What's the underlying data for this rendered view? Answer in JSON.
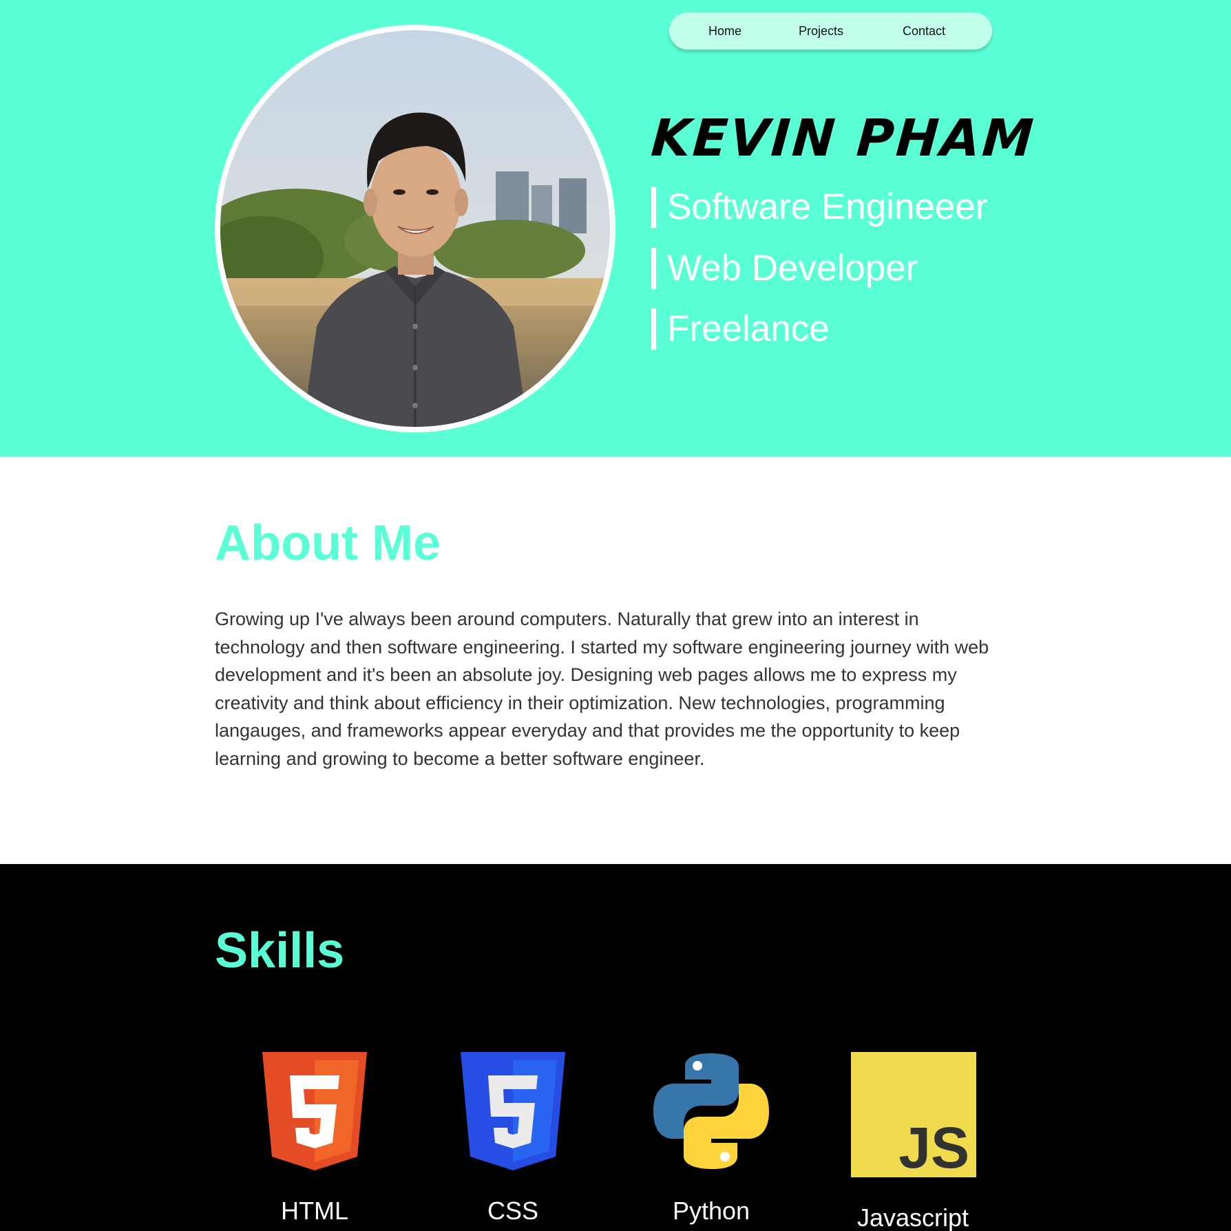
{
  "colors": {
    "accent": "#5bffd6",
    "nav_background": "#c1ffeb",
    "about_background": "#ffffff",
    "skills_background": "#000000",
    "html_orange": "#e44d26",
    "css_blue": "#264de4",
    "python_blue": "#3776ab",
    "python_yellow": "#ffd43b",
    "js_yellow": "#f0db4f"
  },
  "nav": {
    "items": [
      {
        "label": "Home"
      },
      {
        "label": "Projects"
      },
      {
        "label": "Contact"
      }
    ]
  },
  "hero": {
    "name": "KEVIN PHAM",
    "roles": [
      "Software Engineeer",
      "Web Developer",
      "Freelance"
    ],
    "portrait_icon": "profile-photo"
  },
  "about": {
    "title": "About Me",
    "text": "Growing up I've always been around computers. Naturally that grew into an interest in technology and then software engineering. I started my software engineering journey with web development and it's been an absolute joy. Designing web pages allows me to express my creativity and think about efficiency in their optimization. New technologies, programming langauges, and frameworks appear everyday and that provides me the opportunity to keep learning and growing to become a better software engineer."
  },
  "skills": {
    "title": "Skills",
    "items": [
      {
        "label": "HTML",
        "icon": "html5-logo-icon"
      },
      {
        "label": "CSS",
        "icon": "css3-logo-icon"
      },
      {
        "label": "Python",
        "icon": "python-logo-icon"
      },
      {
        "label": "Javascript",
        "icon": "javascript-logo-icon"
      }
    ],
    "js_badge_text": "JS"
  }
}
